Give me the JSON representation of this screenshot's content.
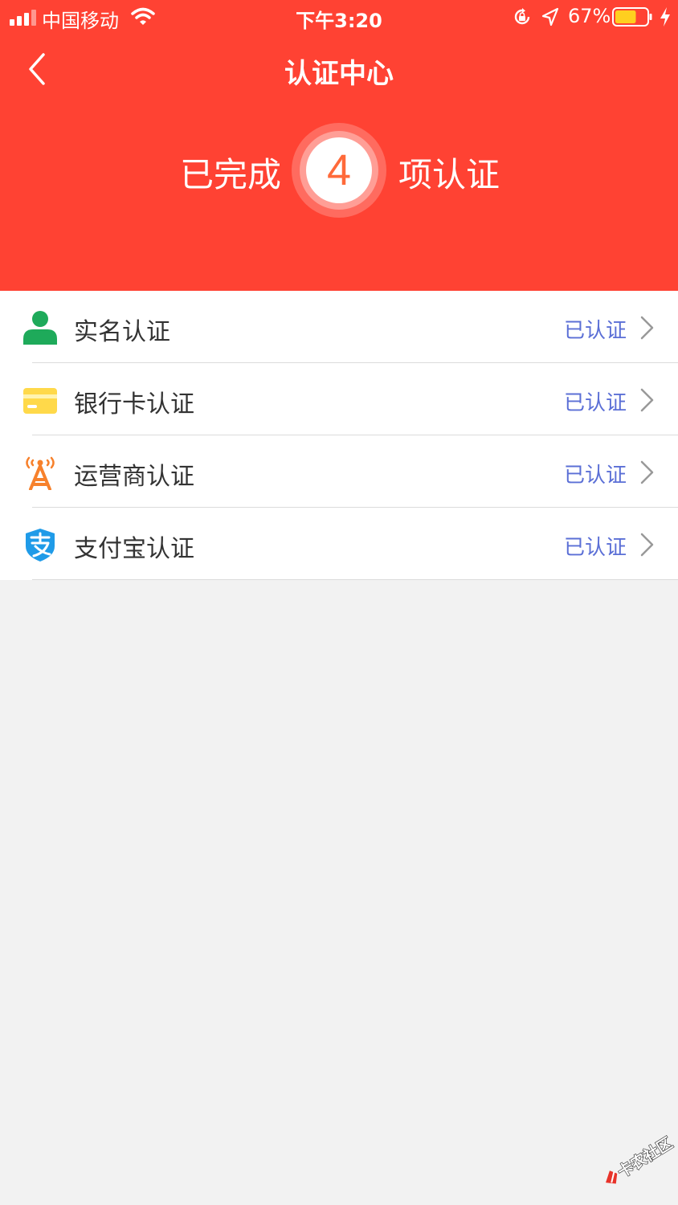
{
  "status_bar": {
    "carrier": "中国移动",
    "time": "下午3:20",
    "battery_percent": "67%",
    "battery_level": 0.67
  },
  "nav": {
    "title": "认证中心"
  },
  "summary": {
    "prefix": "已完成",
    "count": "4",
    "suffix": "项认证"
  },
  "items": [
    {
      "label": "实名认证",
      "status": "已认证",
      "icon": "user-icon",
      "color": "#1eaa5a"
    },
    {
      "label": "银行卡认证",
      "status": "已认证",
      "icon": "bank-card-icon",
      "color": "#ffd94a"
    },
    {
      "label": "运营商认证",
      "status": "已认证",
      "icon": "signal-tower-icon",
      "color": "#f7812c"
    },
    {
      "label": "支付宝认证",
      "status": "已认证",
      "icon": "alipay-icon",
      "color": "#1f9be8"
    }
  ],
  "watermark": "卡农社区",
  "colors": {
    "header": "#ff4233",
    "status_text": "#5b6fd6",
    "background": "#f2f2f2"
  }
}
